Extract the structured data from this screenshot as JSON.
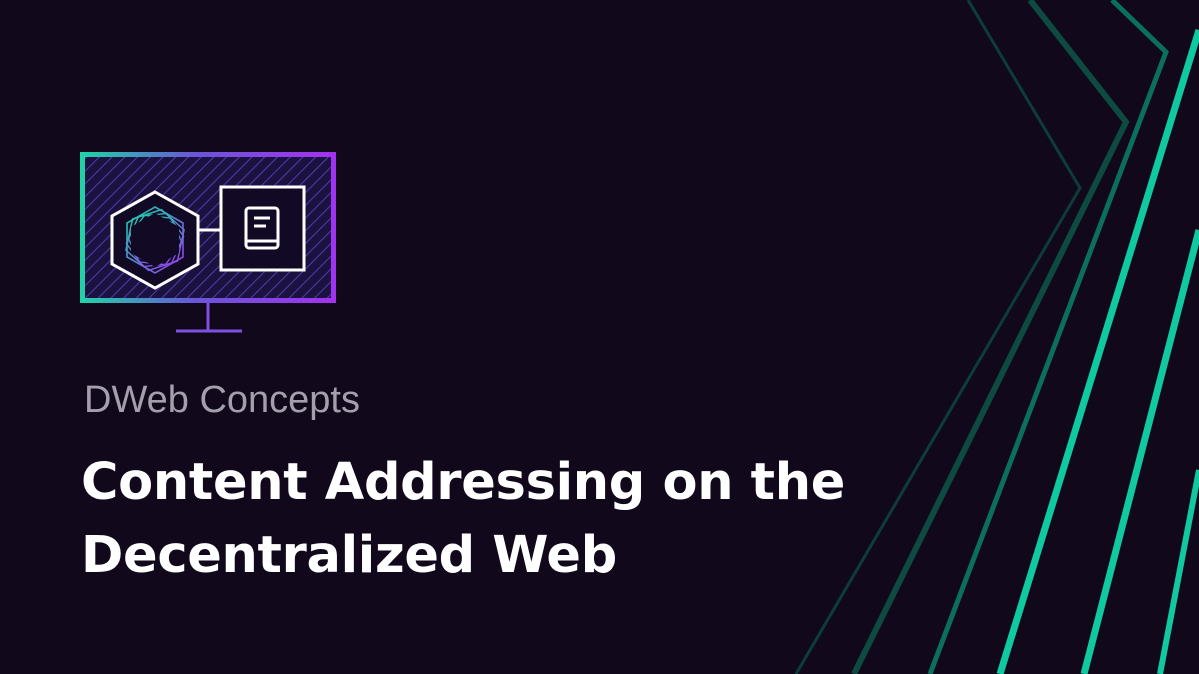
{
  "header": {
    "category": "DWeb Concepts",
    "title_line_1": "Content Addressing on the",
    "title_line_2": "Decentralized Web"
  },
  "illustration": {
    "icons": [
      "monitor-icon",
      "hexagon-cube-icon",
      "book-icon"
    ]
  },
  "colors": {
    "background": "#11081c",
    "accent_teal": "#0cc9a0",
    "accent_purple": "#9d31e8",
    "category_text": "#a49fad",
    "title_text": "#ffffff"
  }
}
